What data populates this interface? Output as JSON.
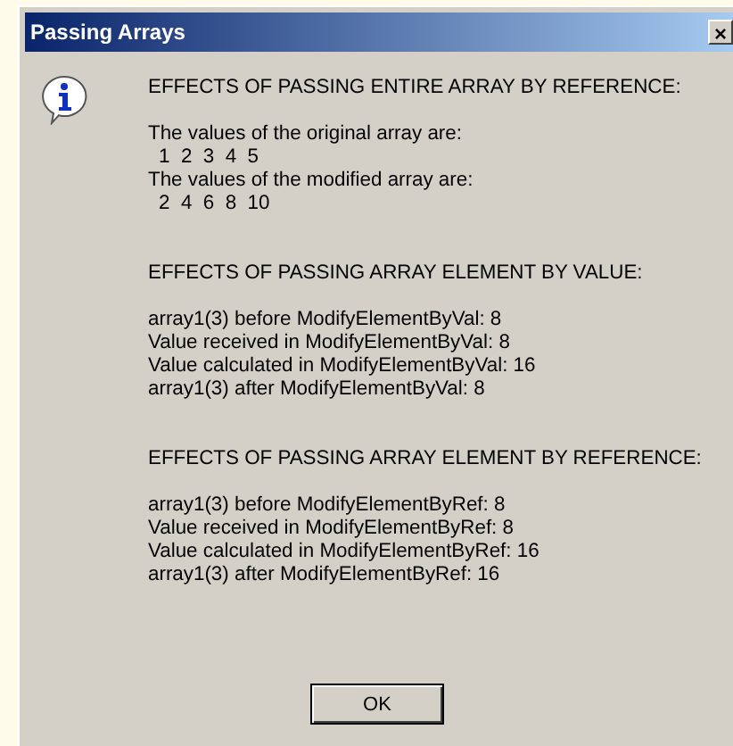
{
  "window": {
    "title": "Passing Arrays",
    "close": "×"
  },
  "message": [
    {
      "heading": "EFFECTS OF PASSING ENTIRE ARRAY BY REFERENCE:",
      "lines": [
        {
          "kind": "text",
          "text": "The values of the original array are:"
        },
        {
          "kind": "values",
          "text": "1  2  3  4  5"
        },
        {
          "kind": "text",
          "text": "The values of the modified array are:"
        },
        {
          "kind": "values",
          "text": "2  4  6  8  10"
        }
      ]
    },
    {
      "heading": "EFFECTS OF PASSING ARRAY ELEMENT BY VALUE:",
      "lines": [
        {
          "kind": "text",
          "text": "array1(3) before ModifyElementByVal: 8"
        },
        {
          "kind": "text",
          "text": "Value received in ModifyElementByVal: 8"
        },
        {
          "kind": "text",
          "text": "Value calculated in ModifyElementByVal: 16"
        },
        {
          "kind": "text",
          "text": "array1(3) after ModifyElementByVal: 8"
        }
      ]
    },
    {
      "heading": "EFFECTS OF PASSING ARRAY ELEMENT BY REFERENCE:",
      "lines": [
        {
          "kind": "text",
          "text": "array1(3) before ModifyElementByRef: 8"
        },
        {
          "kind": "text",
          "text": "Value received in ModifyElementByRef: 8"
        },
        {
          "kind": "text",
          "text": "Value calculated in ModifyElementByRef: 16"
        },
        {
          "kind": "text",
          "text": "array1(3) after ModifyElementByRef: 16"
        }
      ]
    }
  ],
  "buttons": [
    "OK"
  ]
}
